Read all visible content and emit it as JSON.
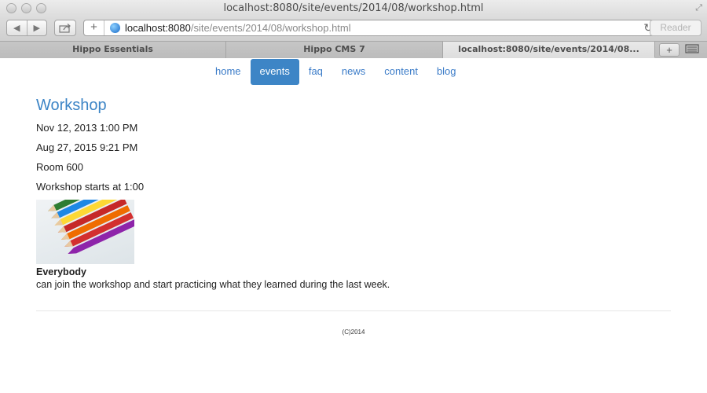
{
  "browser": {
    "window_title": "localhost:8080/site/events/2014/08/workshop.html",
    "url_host": "localhost:8080",
    "url_path": "/site/events/2014/08/workshop.html",
    "reader_label": "Reader",
    "tabs": [
      {
        "label": "Hippo Essentials"
      },
      {
        "label": "Hippo CMS 7"
      },
      {
        "label": "localhost:8080/site/events/2014/08..."
      }
    ]
  },
  "nav": {
    "items": [
      {
        "label": "home"
      },
      {
        "label": "events"
      },
      {
        "label": "faq"
      },
      {
        "label": "news"
      },
      {
        "label": "content"
      },
      {
        "label": "blog"
      }
    ],
    "active": "events"
  },
  "article": {
    "title": "Workshop",
    "start_date": "Nov 12, 2013 1:00 PM",
    "end_date": "Aug 27, 2015 9:21 PM",
    "location": "Room 600",
    "summary": "Workshop starts at 1:00",
    "image_icon": "colored-pencils-image",
    "caption_bold": "Everybody",
    "caption_text": "can join the workshop and start practicing what they learned during the last week."
  },
  "footer": {
    "copyright": "(C)2014"
  },
  "colors": {
    "accent": "#3d85c6",
    "link": "#3a7bc8"
  }
}
